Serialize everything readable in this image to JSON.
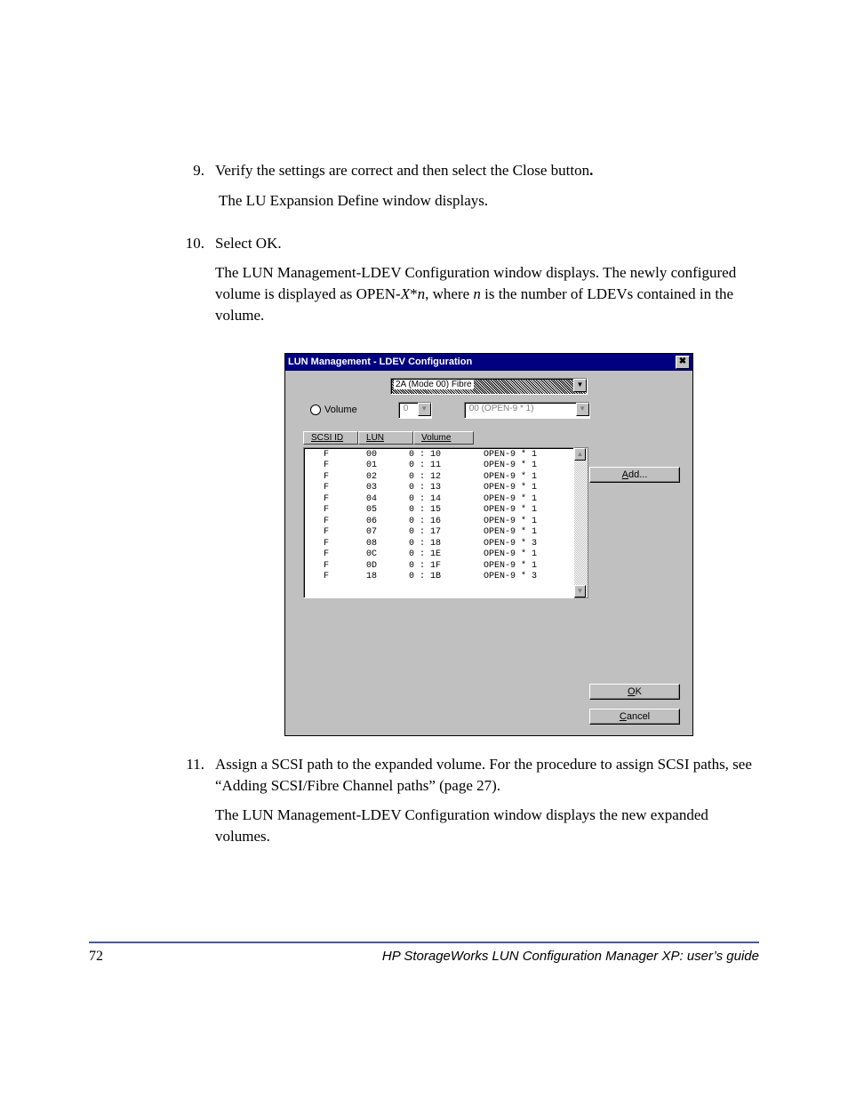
{
  "steps": {
    "s9": {
      "num": "9.",
      "p1_a": "Verify the settings are correct and then select the Close button",
      "p1_b": ".",
      "p2": "The LU Expansion Define window displays."
    },
    "s10": {
      "num": "10.",
      "p1": "Select OK.",
      "p2_a": "The LUN Management-LDEV Configuration window displays. The newly configured volume is displayed as OPEN-",
      "p2_b": "X",
      "p2_c": "*",
      "p2_d": "n",
      "p2_e": ", where ",
      "p2_f": "n",
      "p2_g": " is the number of LDEVs contained in the volume."
    },
    "s11": {
      "num": "11.",
      "p1": "Assign a SCSI path to the expanded volume. For the procedure to assign SCSI paths, see “Adding SCSI/Fibre Channel paths” (page 27).",
      "p2": "The LUN Management-LDEV Configuration window displays the new expanded volumes."
    }
  },
  "dialog": {
    "title": "LUN Management - LDEV Configuration",
    "close_glyph": "✖",
    "port_select": "2A (Mode 00) Fibre",
    "volume_radio": "Volume",
    "vol_num": "0",
    "vol_desc": "00 (OPEN-9 * 1)",
    "headers": {
      "scsi": "SCSI ID",
      "lun": "LUN",
      "volume": "Volume"
    },
    "rows": [
      {
        "s": "F",
        "l": "00",
        "v": "0 : 10",
        "d": "OPEN-9 * 1"
      },
      {
        "s": "F",
        "l": "01",
        "v": "0 : 11",
        "d": "OPEN-9 * 1"
      },
      {
        "s": "F",
        "l": "02",
        "v": "0 : 12",
        "d": "OPEN-9 * 1"
      },
      {
        "s": "F",
        "l": "03",
        "v": "0 : 13",
        "d": "OPEN-9 * 1"
      },
      {
        "s": "F",
        "l": "04",
        "v": "0 : 14",
        "d": "OPEN-9 * 1"
      },
      {
        "s": "F",
        "l": "05",
        "v": "0 : 15",
        "d": "OPEN-9 * 1"
      },
      {
        "s": "F",
        "l": "06",
        "v": "0 : 16",
        "d": "OPEN-9 * 1"
      },
      {
        "s": "F",
        "l": "07",
        "v": "0 : 17",
        "d": "OPEN-9 * 1"
      },
      {
        "s": "F",
        "l": "08",
        "v": "0 : 18",
        "d": "OPEN-9 * 3"
      },
      {
        "s": "F",
        "l": "0C",
        "v": "0 : 1E",
        "d": "OPEN-9 * 1"
      },
      {
        "s": "F",
        "l": "0D",
        "v": "0 : 1F",
        "d": "OPEN-9 * 1"
      },
      {
        "s": "F",
        "l": "18",
        "v": "0 : 1B",
        "d": "OPEN-9 * 3"
      }
    ],
    "buttons": {
      "add": "Add...",
      "ok": "OK",
      "cancel": "Cancel"
    }
  },
  "footer": {
    "page": "72",
    "title": "HP StorageWorks LUN Configuration Manager XP: user’s guide"
  }
}
